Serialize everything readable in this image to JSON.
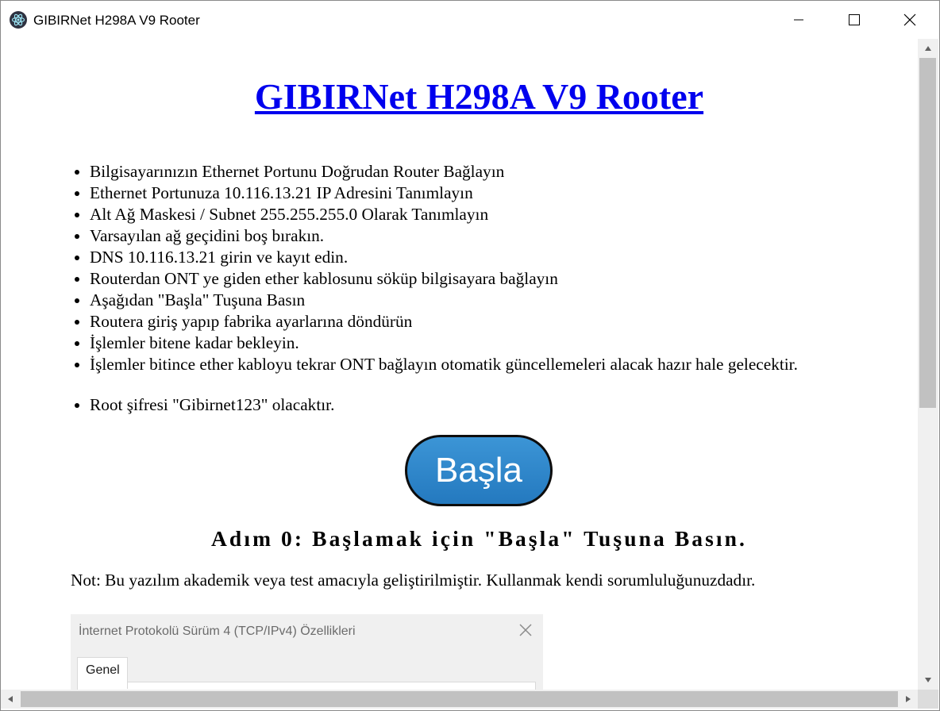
{
  "window": {
    "title": "GIBIRNet H298A V9 Rooter",
    "icon": "electron-app-icon"
  },
  "page": {
    "title": "GIBIRNet H298A V9 Rooter",
    "steps": [
      "Bilgisayarınızın Ethernet Portunu Doğrudan Router Bağlayın",
      "Ethernet Portunuza 10.116.13.21 IP Adresini Tanımlayın",
      "Alt Ağ Maskesi / Subnet 255.255.255.0 Olarak Tanımlayın",
      "Varsayılan ağ geçidini boş bırakın.",
      "DNS 10.116.13.21 girin ve kayıt edin.",
      "Routerdan ONT ye giden ether kablosunu söküp bilgisayara bağlayın",
      "Aşağıdan \"Başla\" Tuşuna Basın",
      "Routera giriş yapıp fabrika ayarlarına döndürün",
      "İşlemler bitene kadar bekleyin.",
      "İşlemler bitince ether kabloyu tekrar ONT bağlayın otomatik güncellemeleri alacak hazır hale gelecektir."
    ],
    "root_note": "Root şifresi \"Gibirnet123\" olacaktır.",
    "start_button": "Başla",
    "step_status": "Adım 0: Başlamak için \"Başla\" Tuşuna Basın.",
    "disclaimer": "Not: Bu yazılım akademik veya test amacıyla geliştirilmiştir. Kullanmak kendi sorumluluğunuzdadır."
  },
  "dialog_image": {
    "title": "İnternet Protokolü Sürüm 4 (TCP/IPv4) Özellikleri",
    "tab": "Genel"
  },
  "colors": {
    "link": "#0000ee",
    "button_fill": "#2f86cb",
    "button_border": "#0d0d0d"
  }
}
